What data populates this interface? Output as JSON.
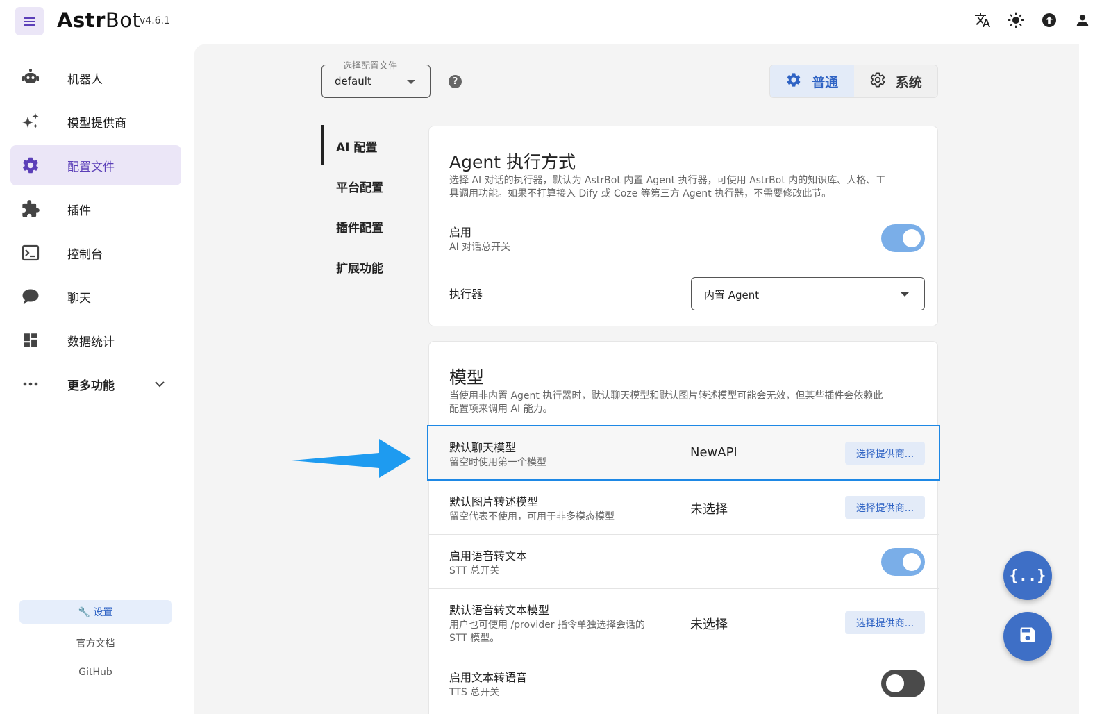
{
  "app": {
    "name_bold": "Astr",
    "name_rest": "Bot",
    "version": "v4.6.1"
  },
  "topbar": {
    "icons": [
      "translate-icon",
      "sun-icon",
      "upload-icon",
      "user-icon"
    ]
  },
  "sidebar": {
    "items": [
      {
        "label": "机器人",
        "icon": "robot-icon"
      },
      {
        "label": "模型提供商",
        "icon": "sparkles-icon"
      },
      {
        "label": "配置文件",
        "icon": "gear-icon",
        "active": true
      },
      {
        "label": "插件",
        "icon": "puzzle-icon"
      },
      {
        "label": "控制台",
        "icon": "console-icon"
      },
      {
        "label": "聊天",
        "icon": "chat-icon"
      },
      {
        "label": "数据统计",
        "icon": "dashboard-icon"
      },
      {
        "label": "更多功能",
        "icon": "more-icon"
      }
    ],
    "settings_label": "🔧 设置",
    "docs_label": "官方文档",
    "github_label": "GitHub"
  },
  "config_select": {
    "legend": "选择配置文件",
    "value": "default"
  },
  "mode_toggle": {
    "normal": "普通",
    "system": "系统"
  },
  "subnav": [
    "AI 配置",
    "平台配置",
    "插件配置",
    "扩展功能"
  ],
  "agent_card": {
    "title": "Agent 执行方式",
    "desc_line1": "选择 AI 对话的执行器，默认为 AstrBot 内置 Agent 执行器，可使用 AstrBot 内的知识库、人格、工",
    "desc_line2": "具调用功能。如果不打算接入 Dify 或 Coze 等第三方 Agent 执行器，不需要修改此节。",
    "enable_title": "启用",
    "enable_sub": "AI 对话总开关",
    "executor_title": "执行器",
    "executor_value": "内置 Agent"
  },
  "model_card": {
    "title": "模型",
    "desc_line1": "当使用非内置 Agent 执行器时，默认聊天模型和默认图片转述模型可能会无效，但某些插件会依赖此",
    "desc_line2": "配置项来调用 AI 能力。",
    "provider_btn": "选择提供商...",
    "chat_model": {
      "title": "默认聊天模型",
      "sub": "留空时使用第一个模型",
      "value": "NewAPI"
    },
    "image_model": {
      "title": "默认图片转述模型",
      "sub": "留空代表不使用，可用于非多模态模型",
      "value": "未选择"
    },
    "stt_enable": {
      "title": "启用语音转文本",
      "sub": "STT 总开关"
    },
    "stt_model": {
      "title": "默认语音转文本模型",
      "sub_line1": "用户也可使用 /provider 指令单独选择会话的",
      "sub_line2": "STT 模型。",
      "value": "未选择"
    },
    "tts_enable": {
      "title": "启用文本转语音",
      "sub": "TTS 总开关"
    }
  },
  "colors": {
    "accent": "#5b3fb8",
    "blue": "#2f63c4",
    "highlight": "#1e88e5",
    "arrow": "#1e9bf0"
  }
}
